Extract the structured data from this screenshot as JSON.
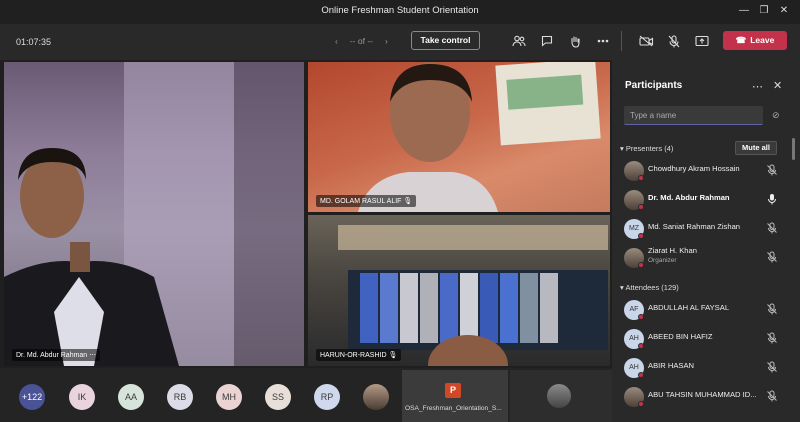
{
  "window": {
    "title": "Online Freshman Student Orientation",
    "minimize": "—",
    "maximize": "❐",
    "close": "✕"
  },
  "toolbar": {
    "timer": "01:07:35",
    "pager_prev": "‹",
    "pager_text": "-- of --",
    "pager_next": "›",
    "take_control": "Take control",
    "leave": "Leave"
  },
  "videos": [
    {
      "name": "Dr. Md. Abdur Rahman",
      "more": "⋯"
    },
    {
      "name": "MD. GOLAM RASUL ALIF"
    },
    {
      "name": "HARUN-OR-RASHID"
    }
  ],
  "strip": {
    "more_count": "+122",
    "avatars": [
      "IK",
      "AA",
      "RB",
      "MH",
      "SS",
      "RP"
    ],
    "avatar_colors": [
      "#e9d3dc",
      "#d6e4dc",
      "#dcdce8",
      "#ecd3d3",
      "#e8e0d8",
      "#cfd8ec"
    ],
    "shared_file": "OSA_Freshman_Orientation_S..."
  },
  "participants": {
    "title": "Participants",
    "search_placeholder": "Type a name",
    "presenters_label": "Presenters (4)",
    "mute_all": "Mute all",
    "attendees_label": "Attendees (129)",
    "presenters": [
      {
        "name": "Chowdhury Akram Hossain",
        "initials": "",
        "photo": true,
        "bold": false,
        "muted": true
      },
      {
        "name": "Dr. Md. Abdur Rahman",
        "initials": "",
        "photo": true,
        "bold": true,
        "muted": false
      },
      {
        "name": "Md. Saniat Rahman Zishan",
        "initials": "MZ",
        "photo": false,
        "bold": false,
        "muted": true
      },
      {
        "name": "Ziarat H. Khan",
        "sub": "Organizer",
        "initials": "",
        "photo": true,
        "bold": false,
        "muted": true
      }
    ],
    "attendees": [
      {
        "name": "ABDULLAH AL FAYSAL",
        "initials": "AF",
        "muted": true
      },
      {
        "name": "ABEED BIN HAFIZ",
        "initials": "AH",
        "muted": true
      },
      {
        "name": "ABIR HASAN",
        "initials": "AH",
        "muted": true
      },
      {
        "name": "ABU TAHSIN MUHAMMAD ID...",
        "initials": "",
        "photo": true,
        "muted": true
      }
    ]
  },
  "colors": {
    "accent": "#6264a7",
    "leave": "#c4314b",
    "panel_bg": "#292929",
    "status_dot": "#c4314b"
  }
}
